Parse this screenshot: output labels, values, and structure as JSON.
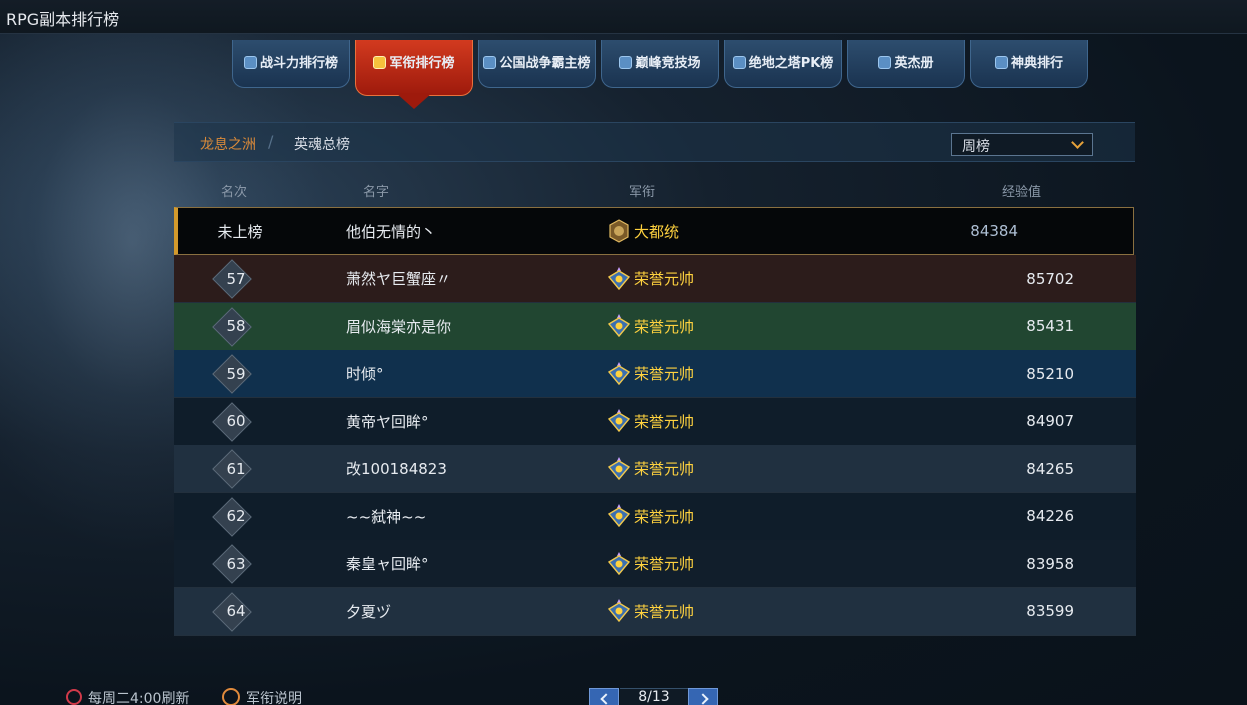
{
  "window": {
    "title": "RPG副本排行榜"
  },
  "tabs": [
    {
      "label": "战斗力排行榜",
      "icon": "shield-icon",
      "active": false
    },
    {
      "label": "军衔排行榜",
      "icon": "badge-icon",
      "active": true
    },
    {
      "label": "公国战争霸主榜",
      "icon": "shield-icon",
      "active": false
    },
    {
      "label": "巅峰竞技场",
      "icon": "crossed-swords-icon",
      "active": false
    },
    {
      "label": "绝地之塔PK榜",
      "icon": "wings-icon",
      "active": false
    },
    {
      "label": "英杰册",
      "icon": "book-icon",
      "active": false
    },
    {
      "label": "神典排行",
      "icon": "book-icon",
      "active": false
    }
  ],
  "breadcrumb": {
    "region": "龙息之洲",
    "separator": "/",
    "board": "英魂总榜"
  },
  "period_select": {
    "value": "周榜"
  },
  "columns": {
    "rank": "名次",
    "name": "名字",
    "title": "军衔",
    "exp": "经验值"
  },
  "self_row": {
    "rank": "未上榜",
    "name": "他伯无情的丶",
    "title": "大都统",
    "exp": "84384"
  },
  "rows": [
    {
      "rank": "57",
      "name": "萧然ヤ巨蟹座〃",
      "title": "荣誉元帅",
      "exp": "85702",
      "bg": "#2c1c1b"
    },
    {
      "rank": "58",
      "name": "眉似海棠亦是你",
      "title": "荣誉元帅",
      "exp": "85431",
      "bg": "#214631"
    },
    {
      "rank": "59",
      "name": "时倾°",
      "title": "荣誉元帅",
      "exp": "85210",
      "bg": "#10304d"
    },
    {
      "rank": "60",
      "name": "黄帝ヤ回眸°",
      "title": "荣誉元帅",
      "exp": "84907",
      "bg": "#0f1d2a"
    },
    {
      "rank": "61",
      "name": "改100184823",
      "title": "荣誉元帅",
      "exp": "84265",
      "bg": "#203040"
    },
    {
      "rank": "62",
      "name": "~~弑神~~",
      "title": "荣誉元帅",
      "exp": "84226",
      "bg": "#0f1d2a"
    },
    {
      "rank": "63",
      "name": "秦皇ャ回眸°",
      "title": "荣誉元帅",
      "exp": "83958",
      "bg": "#111e2b"
    },
    {
      "rank": "64",
      "name": "夕夏ヅ",
      "title": "荣誉元帅",
      "exp": "83599",
      "bg": "#203040"
    }
  ],
  "footer": {
    "refresh_note": "每周二4:00刷新",
    "help_label": "军衔说明",
    "page": "8/13"
  },
  "colors": {
    "accent_gold": "#ffd23f",
    "tab_active": "#c8321a",
    "tab_inactive": "#23415f"
  }
}
